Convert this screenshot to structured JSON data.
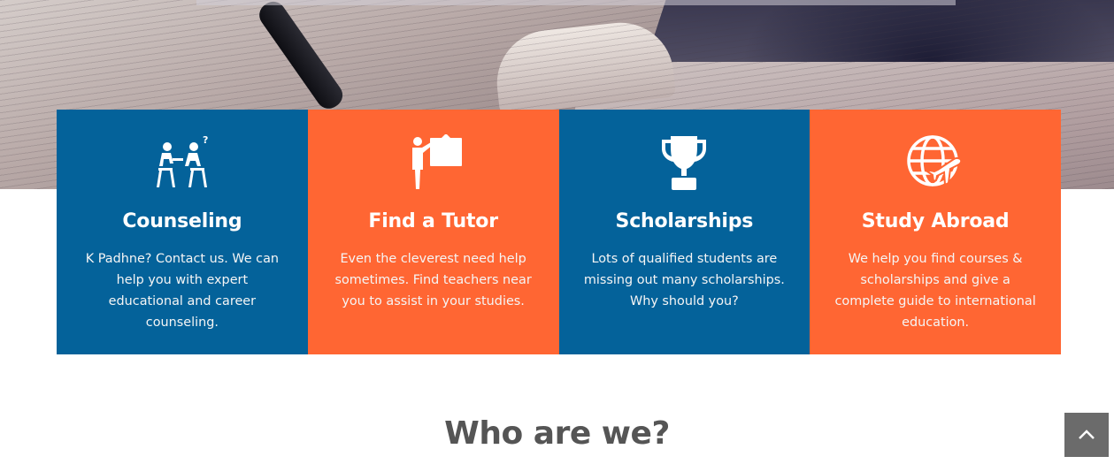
{
  "hero": {
    "image": "open-book-photo"
  },
  "services": [
    {
      "title": "Counseling",
      "text": "K Padhne? Contact us. We can help you with expert educational and career counseling.",
      "icon": "counseling-icon",
      "color": "#04629a"
    },
    {
      "title": "Find a Tutor",
      "text": "Even the cleverest need help sometimes. Find teachers near you to assist in your studies.",
      "icon": "tutor-icon",
      "color": "#ff6633"
    },
    {
      "title": "Scholarships",
      "text": "Lots of qualified students are missing out many scholarships. Why should you?",
      "icon": "trophy-icon",
      "color": "#04629a"
    },
    {
      "title": "Study Abroad",
      "text": "We help you find courses & scholarships and give a complete guide to international education.",
      "icon": "globe-plane-icon",
      "color": "#ff6633"
    }
  ],
  "about": {
    "heading": "Who are we?"
  },
  "scroll_top": {
    "icon": "chevron-up-icon"
  },
  "colors": {
    "blue": "#04629a",
    "orange": "#ff6633",
    "heading_gray": "#555555",
    "scroll_button": "#6b6b6b"
  }
}
